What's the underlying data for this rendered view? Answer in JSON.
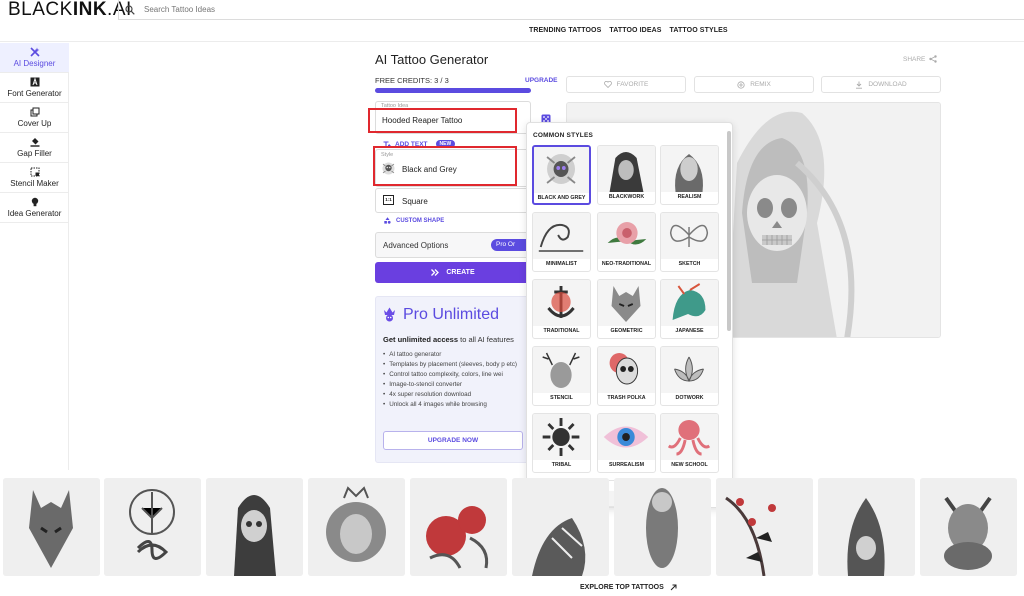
{
  "header": {
    "logo_light": "BLACK",
    "logo_bold": "INK",
    "logo_suffix": ".AI",
    "search_placeholder": "Search Tattoo Ideas",
    "nav": [
      "TRENDING TATTOOS",
      "TATTOO IDEAS",
      "TATTOO STYLES"
    ]
  },
  "sidebar": {
    "items": [
      {
        "label": "AI Designer",
        "icon": "magic-wand-icon",
        "active": true
      },
      {
        "label": "Font Generator",
        "icon": "font-icon",
        "active": false
      },
      {
        "label": "Cover Up",
        "icon": "layers-icon",
        "active": false
      },
      {
        "label": "Gap Filler",
        "icon": "paint-bucket-icon",
        "active": false
      },
      {
        "label": "Stencil Maker",
        "icon": "stencil-icon",
        "active": false
      },
      {
        "label": "Idea Generator",
        "icon": "bulb-icon",
        "active": false
      }
    ]
  },
  "generator": {
    "title": "AI Tattoo Generator",
    "credits_text": "FREE CREDITS: 3 / 3",
    "credits_fraction": 1.0,
    "upgrade_link": "UPGRADE",
    "idea_label": "Tattoo Idea",
    "idea_value": "Hooded Reaper Tattoo",
    "add_text": "ADD TEXT",
    "new_badge": "NEW",
    "style_label": "Style",
    "style_value": "Black and Grey",
    "shape_icon_text": "1:1",
    "shape_value": "Square",
    "custom_shape": "CUSTOM SHAPE",
    "advanced_label": "Advanced Options",
    "pro_pill": "Pro Or",
    "create_label": "CREATE"
  },
  "promo": {
    "title": "Pro Unlimited",
    "sub_bold": "Get unlimited access",
    "sub_rest": " to all AI features",
    "features": [
      "AI tattoo generator",
      "Templates by placement (sleeves, body p etc)",
      "Control tattoo complexity, colors, line wei",
      "Image-to-stencil converter",
      "4x super resolution download",
      "Unlock all 4 images while browsing"
    ],
    "button": "UPGRADE NOW"
  },
  "actions": {
    "share": "SHARE",
    "favorite": "FAVORITE",
    "remix": "REMIX",
    "download": "DOWNLOAD"
  },
  "styles_dropdown": {
    "heading": "COMMON STYLES",
    "styles": [
      {
        "label": "BLACK AND GREY",
        "selected": true,
        "icon": "flower-skull-icon"
      },
      {
        "label": "BLACKWORK",
        "selected": false,
        "icon": "hooded-figure-icon"
      },
      {
        "label": "REALISM",
        "selected": false,
        "icon": "portrait-icon"
      },
      {
        "label": "MINIMALIST",
        "selected": false,
        "icon": "wave-icon"
      },
      {
        "label": "NEO-TRADITIONAL",
        "selected": false,
        "icon": "rose-icon"
      },
      {
        "label": "SKETCH",
        "selected": false,
        "icon": "butterfly-icon"
      },
      {
        "label": "TRADITIONAL",
        "selected": false,
        "icon": "anchor-icon"
      },
      {
        "label": "GEOMETRIC",
        "selected": false,
        "icon": "wolf-icon"
      },
      {
        "label": "JAPANESE",
        "selected": false,
        "icon": "dragon-icon"
      },
      {
        "label": "STENCIL",
        "selected": false,
        "icon": "deer-icon"
      },
      {
        "label": "TRASH POLKA",
        "selected": false,
        "icon": "skull-splatter-icon"
      },
      {
        "label": "DOTWORK",
        "selected": false,
        "icon": "lotus-icon"
      },
      {
        "label": "TRIBAL",
        "selected": false,
        "icon": "sun-icon"
      },
      {
        "label": "SURREALISM",
        "selected": false,
        "icon": "eye-icon"
      },
      {
        "label": "NEW SCHOOL",
        "selected": false,
        "icon": "octopus-icon"
      }
    ]
  },
  "gallery": {
    "items": [
      "wolf-tattoo",
      "tree-infinity-tattoo",
      "reaper-tattoo",
      "lion-tattoo",
      "rose-tattoo",
      "leaf-tattoo",
      "figure-tattoo",
      "crow-branch-tattoo",
      "dragon-skull-tattoo",
      "demon-tattoo"
    ],
    "explore": "EXPLORE TOP TATTOOS"
  },
  "colors": {
    "accent": "#5b4be0",
    "create": "#6a3fe0",
    "highlight": "#e0282e"
  }
}
